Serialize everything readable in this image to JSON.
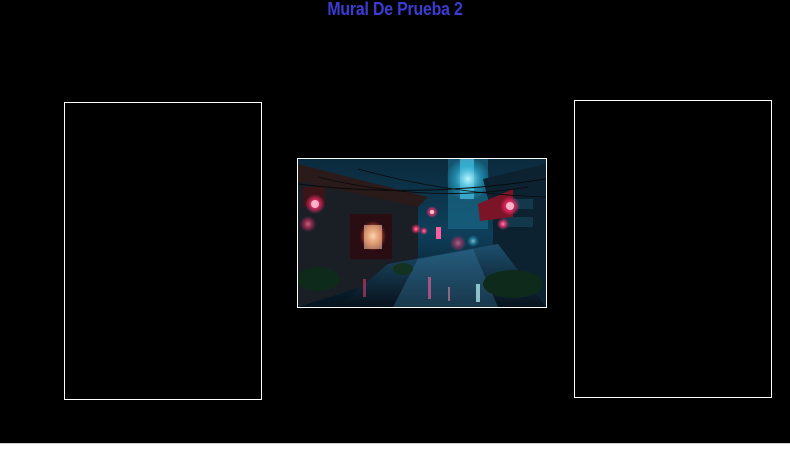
{
  "mural": {
    "title": "Mural De Prueba 2",
    "title_color": "#3b3bd6"
  },
  "frames": [
    {
      "name": "left-frame",
      "content": "empty"
    },
    {
      "name": "center-frame",
      "content": "image",
      "image_description_icon": "neon-alley-image"
    },
    {
      "name": "right-frame",
      "content": "empty"
    }
  ],
  "colors": {
    "background": "#000000",
    "frame_border": "#ffffff"
  }
}
